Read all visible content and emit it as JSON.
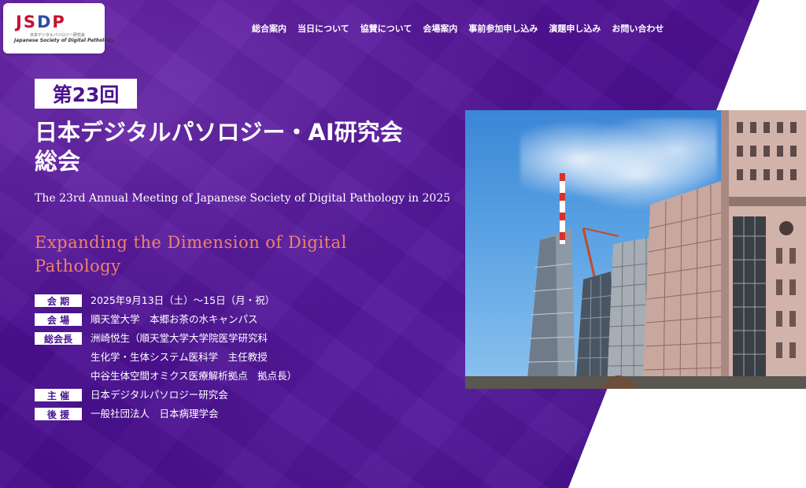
{
  "logo": {
    "mark_left": "JS",
    "mark_accent": "D",
    "mark_right": "P",
    "sub_jp": "日本デジタルパソロジー研究会",
    "sub_en": "Japanese Society of Digital Pathology"
  },
  "nav": {
    "items": [
      {
        "label": "総合案内"
      },
      {
        "label": "当日について"
      },
      {
        "label": "協賛について"
      },
      {
        "label": "会場案内"
      },
      {
        "label": "事前参加申し込み"
      },
      {
        "label": "演題申し込み"
      },
      {
        "label": "お問い合わせ"
      }
    ]
  },
  "hero": {
    "edition": "第23回",
    "title_jp_line1": "日本デジタルパソロジー・AI研究会",
    "title_jp_line2": "総会",
    "title_en": "The 23rd Annual Meeting of Japanese Society of Digital Pathology in 2025",
    "theme": "Expanding the Dimension of Digital Pathology"
  },
  "info": {
    "rows": [
      {
        "label": "会 期",
        "values": [
          "2025年9月13日（土）～15日（月・祝）"
        ]
      },
      {
        "label": "会 場",
        "values": [
          "順天堂大学　本郷お茶の水キャンパス"
        ]
      },
      {
        "label": "総会長",
        "values": [
          "洲崎悦生（順天堂大学大学院医学研究科",
          "生化学・生体システム医科学　主任教授",
          "中谷生体空間オミクス医療解析拠点　拠点長）"
        ]
      },
      {
        "label": "主 催",
        "values": [
          "日本デジタルパソロジー研究会"
        ]
      },
      {
        "label": "後 援",
        "values": [
          "一般社団法人　日本病理学会"
        ]
      }
    ]
  },
  "colors": {
    "purple": "#4a0f8f",
    "theme_orange": "#f0826a",
    "logo_red": "#c8102e",
    "logo_blue": "#2b4fa3"
  }
}
